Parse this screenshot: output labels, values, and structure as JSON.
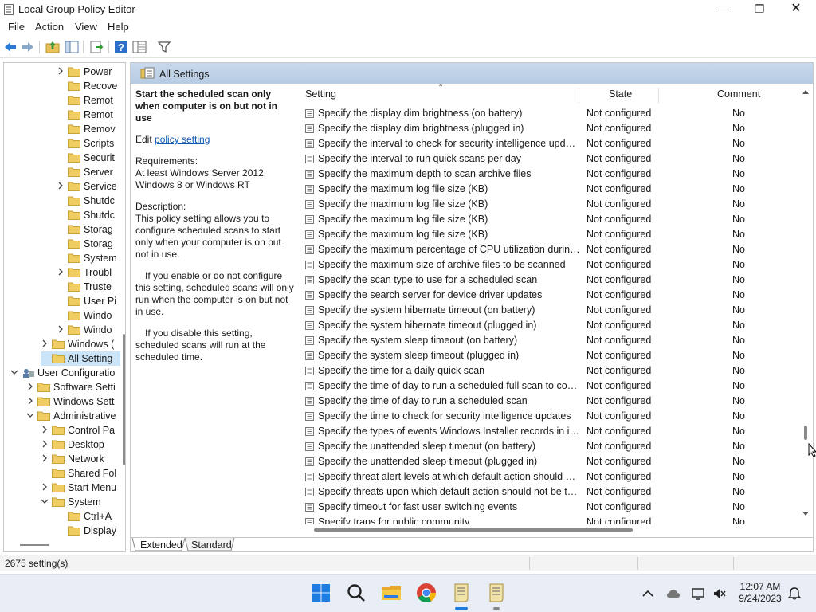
{
  "window": {
    "title": "Local Group Policy Editor"
  },
  "menu": [
    "File",
    "Action",
    "View",
    "Help"
  ],
  "tree": {
    "items": [
      {
        "label": "Power",
        "chev": "right"
      },
      {
        "label": "Recove",
        "chev": ""
      },
      {
        "label": "Remot",
        "chev": ""
      },
      {
        "label": "Remot",
        "chev": ""
      },
      {
        "label": "Remov",
        "chev": ""
      },
      {
        "label": "Scripts",
        "chev": ""
      },
      {
        "label": "Securit",
        "chev": ""
      },
      {
        "label": "Server",
        "chev": ""
      },
      {
        "label": "Service",
        "chev": "right"
      },
      {
        "label": "Shutdc",
        "chev": ""
      },
      {
        "label": "Shutdc",
        "chev": ""
      },
      {
        "label": "Storag",
        "chev": ""
      },
      {
        "label": "Storag",
        "chev": ""
      },
      {
        "label": "System",
        "chev": ""
      },
      {
        "label": "Troubl",
        "chev": "right"
      },
      {
        "label": "Truste",
        "chev": ""
      },
      {
        "label": "User Pi",
        "chev": ""
      },
      {
        "label": "Windo",
        "chev": ""
      },
      {
        "label": "Windo",
        "chev": "right"
      },
      {
        "label": "Windows (",
        "chev": "right"
      },
      {
        "label": "All Setting",
        "chev": ""
      },
      {
        "label": "User Configuratio",
        "chev": "down"
      },
      {
        "label": "Software Setti",
        "chev": "right"
      },
      {
        "label": "Windows Sett",
        "chev": "right"
      },
      {
        "label": "Administrative",
        "chev": "down"
      },
      {
        "label": "Control Pa",
        "chev": "right"
      },
      {
        "label": "Desktop",
        "chev": "right"
      },
      {
        "label": "Network",
        "chev": "right"
      },
      {
        "label": "Shared Fol",
        "chev": ""
      },
      {
        "label": "Start Menu",
        "chev": "right"
      },
      {
        "label": "System",
        "chev": "down"
      },
      {
        "label": "Ctrl+A",
        "chev": ""
      },
      {
        "label": "Display",
        "chev": ""
      }
    ]
  },
  "folder_header": "All Settings",
  "description": {
    "title": "Start the scheduled scan only when computer is on but not in use",
    "edit_prefix": "Edit ",
    "edit_link": "policy setting ",
    "req_label": "Requirements:",
    "req_text": "At least Windows Server 2012, Windows 8 or Windows RT",
    "desc_label": "Description:",
    "desc_text": "This policy setting allows you to configure scheduled scans to start only when your computer is on but not in use.",
    "p2": "If you enable or do not configure this setting, scheduled scans will only run when the computer is on but not in use.",
    "p3": "If you disable this setting, scheduled scans will run at the scheduled time."
  },
  "columns": {
    "setting": "Setting",
    "state": "State",
    "comment": "Comment"
  },
  "rows": [
    {
      "name": "Specify the display dim brightness (on battery)",
      "state": "Not configured",
      "comment": "No"
    },
    {
      "name": "Specify the display dim brightness (plugged in)",
      "state": "Not configured",
      "comment": "No"
    },
    {
      "name": "Specify the interval to check for security intelligence updates",
      "state": "Not configured",
      "comment": "No"
    },
    {
      "name": "Specify the interval to run quick scans per day",
      "state": "Not configured",
      "comment": "No"
    },
    {
      "name": "Specify the maximum depth to scan archive files",
      "state": "Not configured",
      "comment": "No"
    },
    {
      "name": "Specify the maximum log file size (KB)",
      "state": "Not configured",
      "comment": "No"
    },
    {
      "name": "Specify the maximum log file size (KB)",
      "state": "Not configured",
      "comment": "No"
    },
    {
      "name": "Specify the maximum log file size (KB)",
      "state": "Not configured",
      "comment": "No"
    },
    {
      "name": "Specify the maximum log file size (KB)",
      "state": "Not configured",
      "comment": "No"
    },
    {
      "name": "Specify the maximum percentage of CPU utilization during ...",
      "state": "Not configured",
      "comment": "No"
    },
    {
      "name": "Specify the maximum size of archive files to be scanned",
      "state": "Not configured",
      "comment": "No"
    },
    {
      "name": "Specify the scan type to use for a scheduled scan",
      "state": "Not configured",
      "comment": "No"
    },
    {
      "name": "Specify the search server for device driver updates",
      "state": "Not configured",
      "comment": "No"
    },
    {
      "name": "Specify the system hibernate timeout (on battery)",
      "state": "Not configured",
      "comment": "No"
    },
    {
      "name": "Specify the system hibernate timeout (plugged in)",
      "state": "Not configured",
      "comment": "No"
    },
    {
      "name": "Specify the system sleep timeout (on battery)",
      "state": "Not configured",
      "comment": "No"
    },
    {
      "name": "Specify the system sleep timeout (plugged in)",
      "state": "Not configured",
      "comment": "No"
    },
    {
      "name": "Specify the time for a daily quick scan",
      "state": "Not configured",
      "comment": "No"
    },
    {
      "name": "Specify the time of day to run a scheduled full scan to comp...",
      "state": "Not configured",
      "comment": "No"
    },
    {
      "name": "Specify the time of day to run a scheduled scan",
      "state": "Not configured",
      "comment": "No"
    },
    {
      "name": "Specify the time to check for security intelligence updates",
      "state": "Not configured",
      "comment": "No"
    },
    {
      "name": "Specify the types of events Windows Installer records in its tr...",
      "state": "Not configured",
      "comment": "No"
    },
    {
      "name": "Specify the unattended sleep timeout (on battery)",
      "state": "Not configured",
      "comment": "No"
    },
    {
      "name": "Specify the unattended sleep timeout (plugged in)",
      "state": "Not configured",
      "comment": "No"
    },
    {
      "name": "Specify threat alert levels at which default action should not ...",
      "state": "Not configured",
      "comment": "No"
    },
    {
      "name": "Specify threats upon which default action should not be tak...",
      "state": "Not configured",
      "comment": "No"
    },
    {
      "name": "Specify timeout for fast user switching events",
      "state": "Not configured",
      "comment": "No"
    },
    {
      "name": "Specify traps for public community",
      "state": "Not configured",
      "comment": "No"
    }
  ],
  "tabs": [
    "Extended",
    "Standard"
  ],
  "status": "2675 setting(s)",
  "clock": {
    "time": "12:07 AM",
    "date": "9/24/2023"
  },
  "colors": {
    "accent": "#0b58b3",
    "selection": "#cce4f7",
    "header_band": "#c0d3e9",
    "folder": "#e8c25a"
  }
}
